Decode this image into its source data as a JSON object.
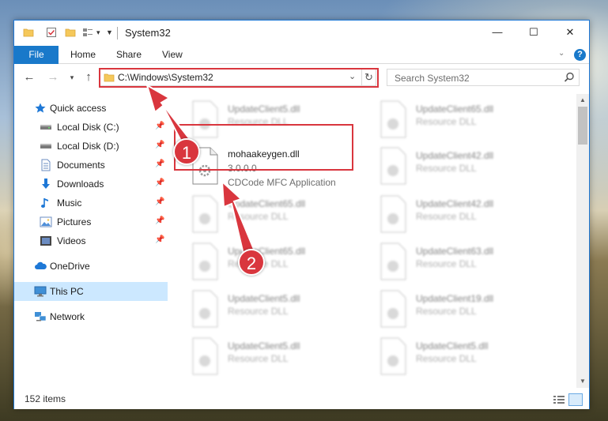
{
  "titlebar": {
    "title": "System32",
    "minimize_glyph": "—",
    "maximize_glyph": "☐",
    "close_glyph": "✕"
  },
  "ribbon": {
    "tabs": [
      "File",
      "Home",
      "Share",
      "View"
    ],
    "help_glyph": "?"
  },
  "address": {
    "path": "C:\\Windows\\System32",
    "search_placeholder": "Search System32"
  },
  "sidebar": {
    "items": [
      {
        "label": "Quick access",
        "icon": "star-icon"
      },
      {
        "label": "Local Disk (C:)",
        "icon": "drive-icon",
        "pinned": true
      },
      {
        "label": "Local Disk (D:)",
        "icon": "drive-icon",
        "pinned": true
      },
      {
        "label": "Documents",
        "icon": "documents-icon",
        "pinned": true
      },
      {
        "label": "Downloads",
        "icon": "download-icon",
        "pinned": true
      },
      {
        "label": "Music",
        "icon": "music-icon",
        "pinned": true
      },
      {
        "label": "Pictures",
        "icon": "pictures-icon",
        "pinned": true
      },
      {
        "label": "Videos",
        "icon": "videos-icon",
        "pinned": true
      },
      {
        "label": "OneDrive",
        "icon": "cloud-icon"
      },
      {
        "label": "This PC",
        "icon": "computer-icon",
        "selected": true
      },
      {
        "label": "Network",
        "icon": "network-icon"
      }
    ]
  },
  "files": {
    "highlighted": {
      "name": "mohaakeygen.dll",
      "version": "3.0.0.0",
      "description": "CDCode MFC Application"
    },
    "blurred": [
      {
        "name": "UpdateClient5.dll",
        "desc": "Resource DLL"
      },
      {
        "name": "UpdateClient65.dll",
        "desc": "Resource DLL"
      },
      {
        "name": "UpdateClient42.dll",
        "desc": "Resource DLL"
      },
      {
        "name": "UpdateClient65.dll",
        "desc": "Resource DLL"
      },
      {
        "name": "UpdateClient42.dll",
        "desc": "Resource DLL"
      },
      {
        "name": "UpdateClient65.dll",
        "desc": "Resource DLL"
      },
      {
        "name": "UpdateClient63.dll",
        "desc": "Resource DLL"
      },
      {
        "name": "UpdateClient5.dll",
        "desc": "Resource DLL"
      },
      {
        "name": "UpdateClient19.dll",
        "desc": "Resource DLL"
      },
      {
        "name": "UpdateClient5.dll",
        "desc": "Resource DLL"
      },
      {
        "name": "UpdateClient5.dll",
        "desc": "Resource DLL"
      }
    ]
  },
  "status": {
    "item_count": "152 items"
  },
  "annotations": {
    "step1": "1",
    "step2": "2",
    "highlight_color": "#d9363e"
  }
}
